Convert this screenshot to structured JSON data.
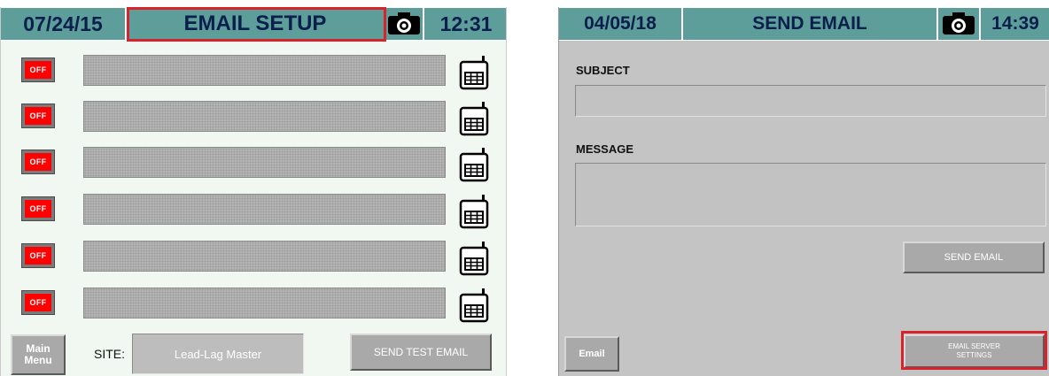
{
  "email_setup": {
    "date": "07/24/15",
    "title": "EMAIL SETUP",
    "time": "12:31",
    "camera_icon": "camera-icon",
    "rows": [
      {
        "toggle_label": "OFF",
        "address": "",
        "icon": "phone-icon"
      },
      {
        "toggle_label": "OFF",
        "address": "",
        "icon": "phone-icon"
      },
      {
        "toggle_label": "OFF",
        "address": "",
        "icon": "phone-icon"
      },
      {
        "toggle_label": "OFF",
        "address": "",
        "icon": "phone-icon"
      },
      {
        "toggle_label": "OFF",
        "address": "",
        "icon": "phone-icon"
      },
      {
        "toggle_label": "OFF",
        "address": "",
        "icon": "phone-icon"
      }
    ],
    "main_menu_label": "Main Menu",
    "site_label": "SITE:",
    "site_value": "Lead-Lag Master",
    "send_test_label": "SEND TEST EMAIL"
  },
  "send_email": {
    "date": "04/05/18",
    "title": "SEND EMAIL",
    "time": "14:39",
    "camera_icon": "camera-icon",
    "subject_label": "SUBJECT",
    "subject_value": "",
    "message_label": "MESSAGE",
    "message_value": "",
    "send_label": "SEND EMAIL",
    "email_tab_label": "Email",
    "server_settings_label": "EMAIL SERVER SETTINGS"
  },
  "colors": {
    "header_teal": "#5e9e9a",
    "header_text": "#0b1f4c",
    "toggle_off": "#ff0000",
    "highlight": "#d8232a"
  }
}
